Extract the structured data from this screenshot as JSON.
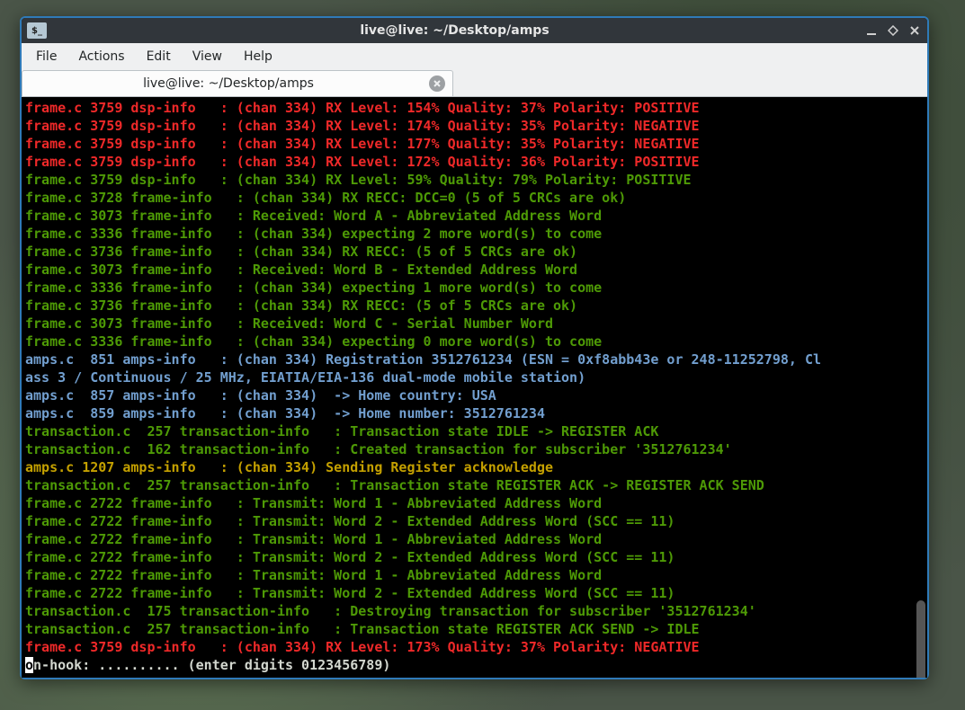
{
  "window": {
    "title": "live@live: ~/Desktop/amps",
    "appicon_text": "$_"
  },
  "menu": {
    "file": "File",
    "actions": "Actions",
    "edit": "Edit",
    "view": "View",
    "help": "Help"
  },
  "tab": {
    "title": "live@live: ~/Desktop/amps"
  },
  "lines": [
    {
      "cls": "c-red",
      "text": "frame.c 3759 dsp-info   : (chan 334) RX Level: 154% Quality: 37% Polarity: POSITIVE"
    },
    {
      "cls": "c-red",
      "text": "frame.c 3759 dsp-info   : (chan 334) RX Level: 174% Quality: 35% Polarity: NEGATIVE"
    },
    {
      "cls": "c-red",
      "text": "frame.c 3759 dsp-info   : (chan 334) RX Level: 177% Quality: 35% Polarity: NEGATIVE"
    },
    {
      "cls": "c-red",
      "text": "frame.c 3759 dsp-info   : (chan 334) RX Level: 172% Quality: 36% Polarity: POSITIVE"
    },
    {
      "cls": "c-green",
      "text": "frame.c 3759 dsp-info   : (chan 334) RX Level: 59% Quality: 79% Polarity: POSITIVE"
    },
    {
      "cls": "c-green",
      "text": "frame.c 3728 frame-info   : (chan 334) RX RECC: DCC=0 (5 of 5 CRCs are ok)"
    },
    {
      "cls": "c-green",
      "text": "frame.c 3073 frame-info   : Received: Word A - Abbreviated Address Word"
    },
    {
      "cls": "c-green",
      "text": "frame.c 3336 frame-info   : (chan 334) expecting 2 more word(s) to come"
    },
    {
      "cls": "c-green",
      "text": "frame.c 3736 frame-info   : (chan 334) RX RECC: (5 of 5 CRCs are ok)"
    },
    {
      "cls": "c-green",
      "text": "frame.c 3073 frame-info   : Received: Word B - Extended Address Word"
    },
    {
      "cls": "c-green",
      "text": "frame.c 3336 frame-info   : (chan 334) expecting 1 more word(s) to come"
    },
    {
      "cls": "c-green",
      "text": "frame.c 3736 frame-info   : (chan 334) RX RECC: (5 of 5 CRCs are ok)"
    },
    {
      "cls": "c-green",
      "text": "frame.c 3073 frame-info   : Received: Word C - Serial Number Word"
    },
    {
      "cls": "c-green",
      "text": "frame.c 3336 frame-info   : (chan 334) expecting 0 more word(s) to come"
    },
    {
      "cls": "c-blue",
      "text": "amps.c  851 amps-info   : (chan 334) Registration 3512761234 (ESN = 0xf8abb43e or 248-11252798, Cl"
    },
    {
      "cls": "c-blue",
      "text": "ass 3 / Continuous / 25 MHz, EIATIA/EIA-136 dual-mode mobile station)"
    },
    {
      "cls": "c-blue",
      "text": "amps.c  857 amps-info   : (chan 334)  -> Home country: USA"
    },
    {
      "cls": "c-blue",
      "text": "amps.c  859 amps-info   : (chan 334)  -> Home number: 3512761234"
    },
    {
      "cls": "c-green",
      "text": "transaction.c  257 transaction-info   : Transaction state IDLE -> REGISTER ACK"
    },
    {
      "cls": "c-green",
      "text": "transaction.c  162 transaction-info   : Created transaction for subscriber '3512761234'"
    },
    {
      "cls": "c-yellow",
      "text": "amps.c 1207 amps-info   : (chan 334) Sending Register acknowledge"
    },
    {
      "cls": "c-green",
      "text": "transaction.c  257 transaction-info   : Transaction state REGISTER ACK -> REGISTER ACK SEND"
    },
    {
      "cls": "c-green",
      "text": "frame.c 2722 frame-info   : Transmit: Word 1 - Abbreviated Address Word"
    },
    {
      "cls": "c-green",
      "text": "frame.c 2722 frame-info   : Transmit: Word 2 - Extended Address Word (SCC == 11)"
    },
    {
      "cls": "c-green",
      "text": "frame.c 2722 frame-info   : Transmit: Word 1 - Abbreviated Address Word"
    },
    {
      "cls": "c-green",
      "text": "frame.c 2722 frame-info   : Transmit: Word 2 - Extended Address Word (SCC == 11)"
    },
    {
      "cls": "c-green",
      "text": "frame.c 2722 frame-info   : Transmit: Word 1 - Abbreviated Address Word"
    },
    {
      "cls": "c-green",
      "text": "frame.c 2722 frame-info   : Transmit: Word 2 - Extended Address Word (SCC == 11)"
    },
    {
      "cls": "c-green",
      "text": "transaction.c  175 transaction-info   : Destroying transaction for subscriber '3512761234'"
    },
    {
      "cls": "c-green",
      "text": "transaction.c  257 transaction-info   : Transaction state REGISTER ACK SEND -> IDLE"
    },
    {
      "cls": "c-red",
      "text": "frame.c 3759 dsp-info   : (chan 334) RX Level: 173% Quality: 37% Polarity: NEGATIVE"
    }
  ],
  "prompt": {
    "cursor_char": "o",
    "rest": "n-hook: .......... (enter digits 0123456789)"
  }
}
